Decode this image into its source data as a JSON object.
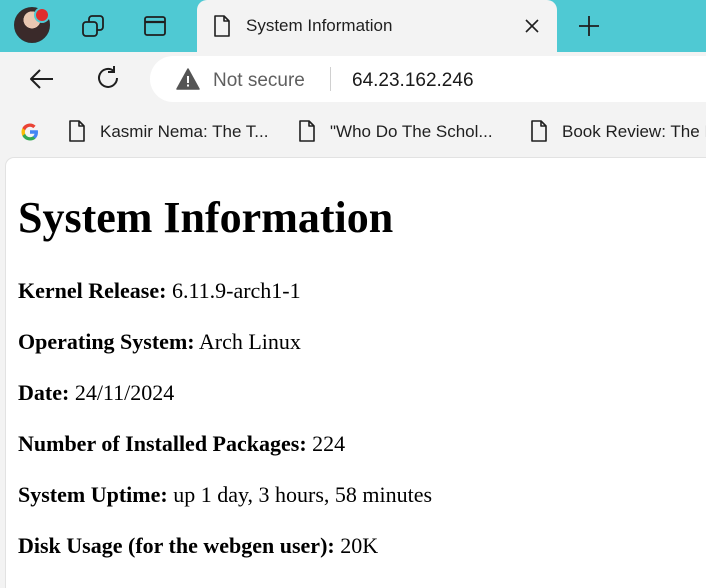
{
  "browser": {
    "tab": {
      "title": "System Information"
    },
    "address_bar": {
      "security_label": "Not secure",
      "url": "64.23.162.246"
    },
    "bookmarks": [
      {
        "label": "Kasmir Nema: The T..."
      },
      {
        "label": "\"Who Do The Schol..."
      },
      {
        "label": "Book Review: The I"
      }
    ]
  },
  "page": {
    "heading": "System Information",
    "items": [
      {
        "label": "Kernel Release:",
        "value": "6.11.9-arch1-1"
      },
      {
        "label": "Operating System:",
        "value": "Arch Linux"
      },
      {
        "label": "Date:",
        "value": "24/11/2024"
      },
      {
        "label": "Number of Installed Packages:",
        "value": "224"
      },
      {
        "label": "System Uptime:",
        "value": "up 1 day, 3 hours, 58 minutes"
      },
      {
        "label": "Disk Usage (for the webgen user):",
        "value": "20K"
      }
    ]
  },
  "colors": {
    "tabstrip": "#4fc9d3",
    "notification_dot": "#e02c2c"
  },
  "icons": [
    "profile-avatar",
    "workspaces-icon",
    "tab-actions-icon",
    "document-icon",
    "close-icon",
    "plus-icon",
    "back-arrow-icon",
    "reload-icon",
    "warning-icon",
    "google-icon"
  ]
}
